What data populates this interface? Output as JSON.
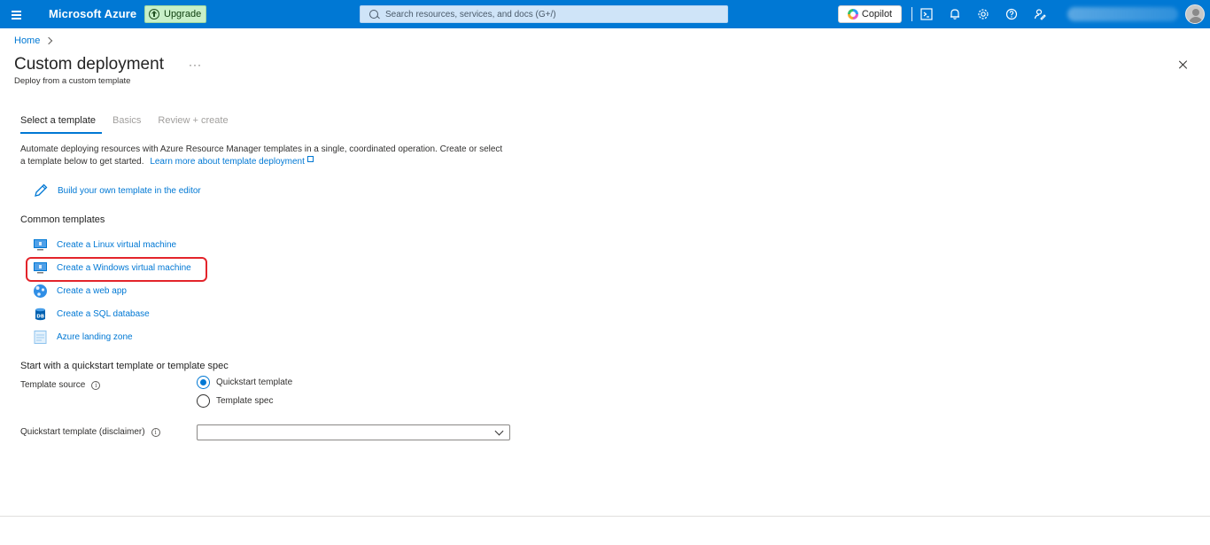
{
  "topbar": {
    "brand": "Microsoft Azure",
    "upgrade_label": "Upgrade",
    "search_placeholder": "Search resources, services, and docs (G+/)",
    "copilot_label": "Copilot",
    "icons": [
      "menu-icon",
      "cloud-shell-icon",
      "notifications-icon",
      "settings-icon",
      "help-icon",
      "feedback-icon"
    ],
    "accent_color": "#0078d4"
  },
  "breadcrumb": {
    "home": "Home"
  },
  "page": {
    "title": "Custom deployment",
    "ellipsis": "···",
    "subtitle": "Deploy from a custom template"
  },
  "tabs": [
    {
      "label": "Select a template",
      "active": true
    },
    {
      "label": "Basics",
      "active": false
    },
    {
      "label": "Review + create",
      "active": false
    }
  ],
  "intro": {
    "text": "Automate deploying resources with Azure Resource Manager templates in a single, coordinated operation. Create or select a template below to get started.",
    "link": "Learn more about template deployment"
  },
  "build_link": "Build your own template in the editor",
  "common_templates": {
    "title": "Common templates",
    "items": [
      {
        "label": "Create a Linux virtual machine",
        "icon": "virtual-machine-icon"
      },
      {
        "label": "Create a Windows virtual machine",
        "icon": "virtual-machine-icon",
        "highlighted": true
      },
      {
        "label": "Create a web app",
        "icon": "web-app-icon"
      },
      {
        "label": "Create a SQL database",
        "icon": "sql-database-icon"
      },
      {
        "label": "Azure landing zone",
        "icon": "landing-zone-icon"
      }
    ]
  },
  "quickstart": {
    "title": "Start with a quickstart template or template spec",
    "source_label": "Template source",
    "options": [
      {
        "label": "Quickstart template",
        "checked": true
      },
      {
        "label": "Template spec",
        "checked": false
      }
    ],
    "template_label": "Quickstart template (disclaimer)",
    "template_value": ""
  }
}
